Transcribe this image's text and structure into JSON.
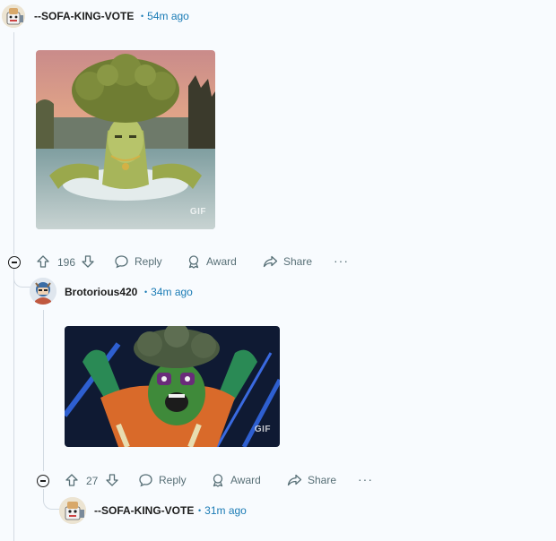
{
  "comments": [
    {
      "username": "--SOFA-KING-VOTE",
      "time": "54m ago",
      "gif_label": "GIF",
      "votes": "196",
      "reply_label": "Reply",
      "award_label": "Award",
      "share_label": "Share",
      "more_label": "···"
    },
    {
      "username": "Brotorious420",
      "time": "34m ago",
      "gif_label": "GIF",
      "votes": "27",
      "reply_label": "Reply",
      "award_label": "Award",
      "share_label": "Share",
      "more_label": "···"
    },
    {
      "username": "--SOFA-KING-VOTE",
      "time": "31m ago"
    }
  ],
  "separator": "•",
  "colors": {
    "timestamp": "#1a7bb5",
    "thread_line": "#d3dbe3",
    "action_text": "#576f76"
  }
}
